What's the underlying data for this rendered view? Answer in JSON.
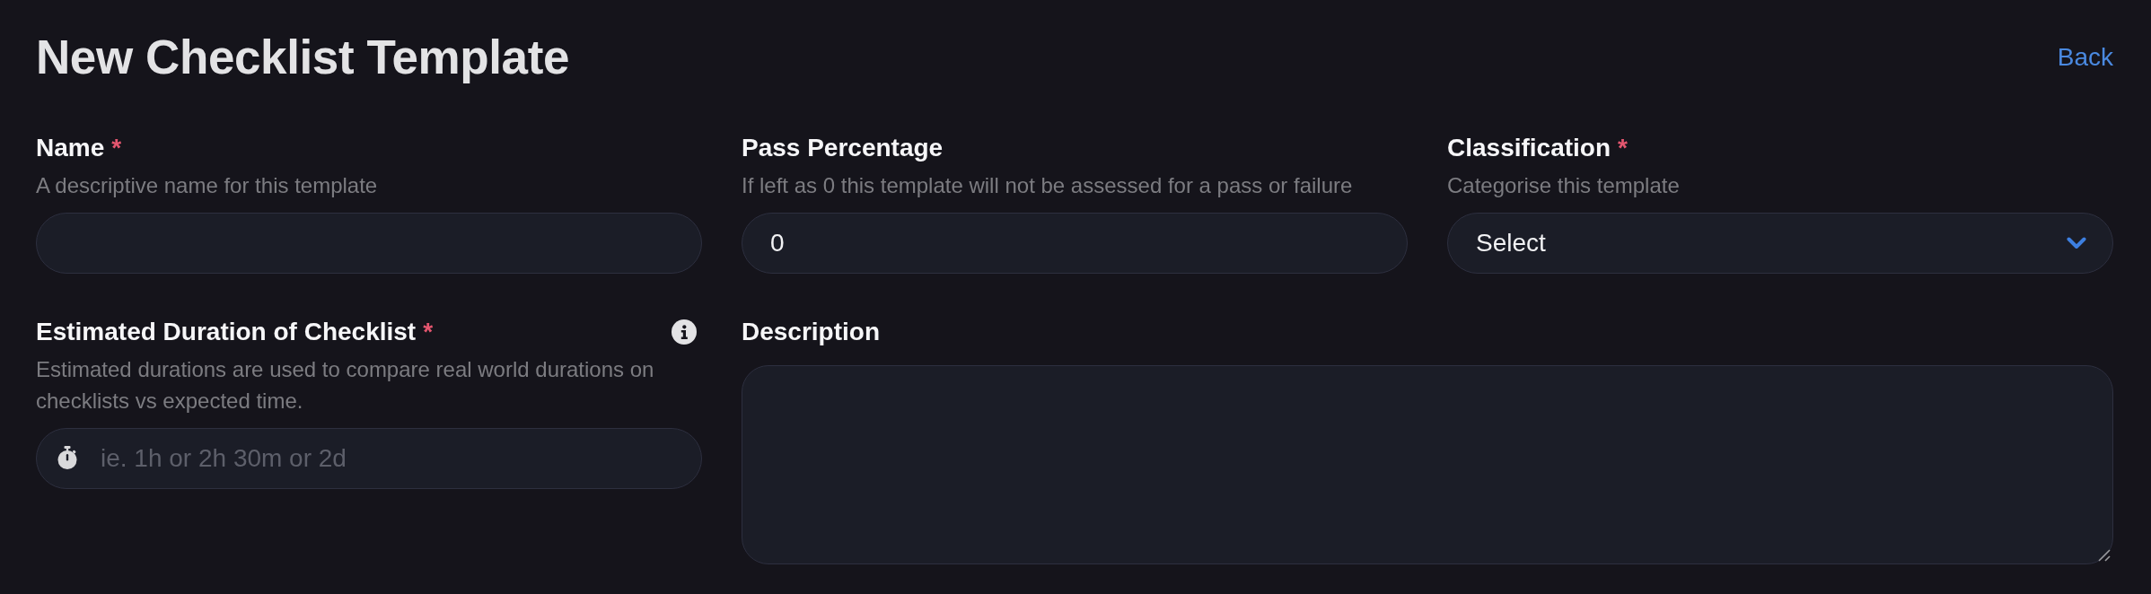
{
  "header": {
    "title": "New Checklist Template",
    "back_link": "Back"
  },
  "fields": [
    {
      "kind": "text",
      "label": "Name",
      "required_mark": "*",
      "info": false,
      "help": "A descriptive name for this template"
    },
    {
      "kind": "text",
      "label": "Pass Percentage",
      "info": false,
      "help": "If left as 0 this template will not be assessed for a pass or failure",
      "value": "0"
    },
    {
      "kind": "select",
      "label": "Classification",
      "required_mark": "*",
      "info": false,
      "help": "Categorise this template",
      "value": "Select"
    },
    {
      "kind": "duration",
      "label": "Estimated Duration of Checklist",
      "required_mark": "*",
      "info": true,
      "help": "Estimated durations are used to compare real world durations on checklists vs expected time.",
      "placeholder": "ie. 1h or 2h 30m or 2d"
    },
    {
      "kind": "textarea",
      "label": "Description",
      "info": false
    }
  ]
}
